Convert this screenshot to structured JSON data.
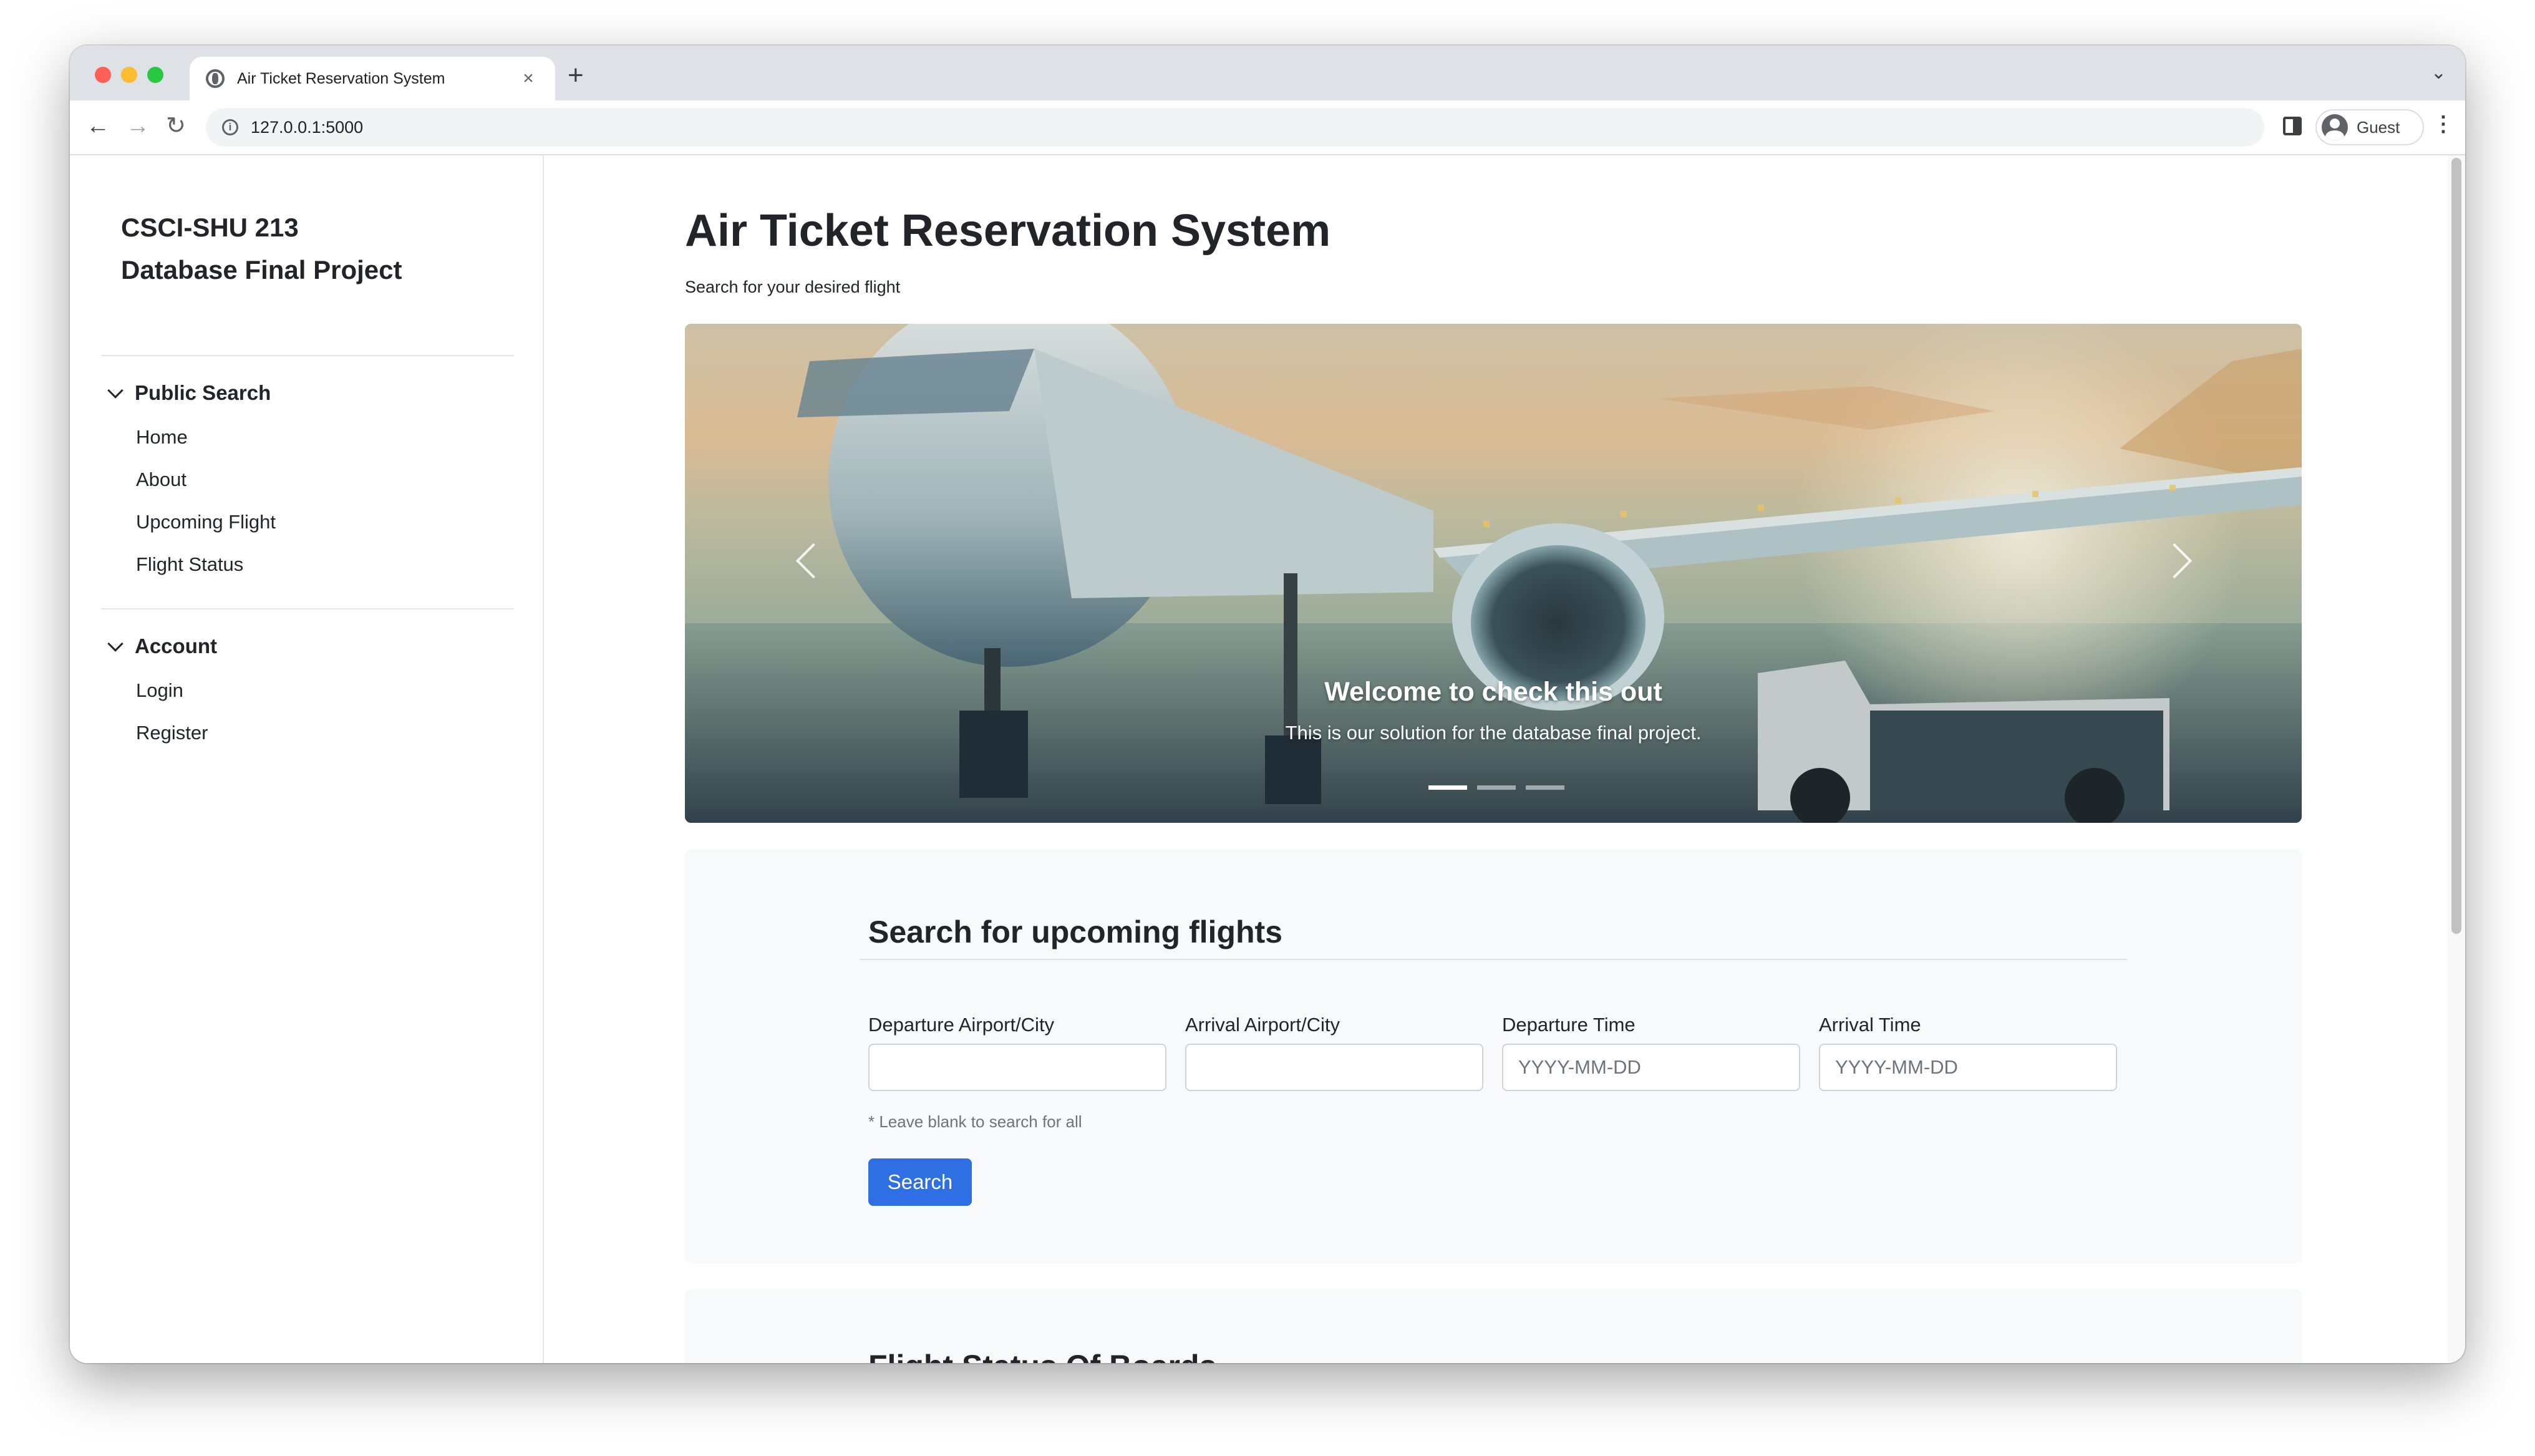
{
  "browser": {
    "tab_title": "Air Ticket Reservation System",
    "tab_close": "×",
    "new_tab": "+",
    "tab_list": "⌄",
    "url": "127.0.0.1:5000",
    "profile_name": "Guest",
    "menu": "⋮",
    "back": "←",
    "forward": "→",
    "reload": "↻",
    "info": "i"
  },
  "sidebar": {
    "brand_line1": "CSCI-SHU 213",
    "brand_line2": "Database Final Project",
    "sections": [
      {
        "title": "Public Search",
        "items": [
          "Home",
          "About",
          "Upcoming Flight",
          "Flight Status"
        ]
      },
      {
        "title": "Account",
        "items": [
          "Login",
          "Register"
        ]
      }
    ]
  },
  "main": {
    "title": "Air Ticket Reservation System",
    "subtitle": "Search for your desired flight"
  },
  "carousel": {
    "caption_title": "Welcome to check this out",
    "caption_text": "This is our solution for the database final project.",
    "slide_count": 3,
    "active_slide": 1
  },
  "search": {
    "title": "Search for upcoming flights",
    "fields": [
      {
        "label": "Departure Airport/City",
        "placeholder": ""
      },
      {
        "label": "Arrival Airport/City",
        "placeholder": ""
      },
      {
        "label": "Departure Time",
        "placeholder": "YYYY-MM-DD"
      },
      {
        "label": "Arrival Time",
        "placeholder": "YYYY-MM-DD"
      }
    ],
    "hint": "* Leave blank to search for all",
    "button_label": "Search"
  },
  "next_section": {
    "title": "Flight Status Of Boards"
  }
}
